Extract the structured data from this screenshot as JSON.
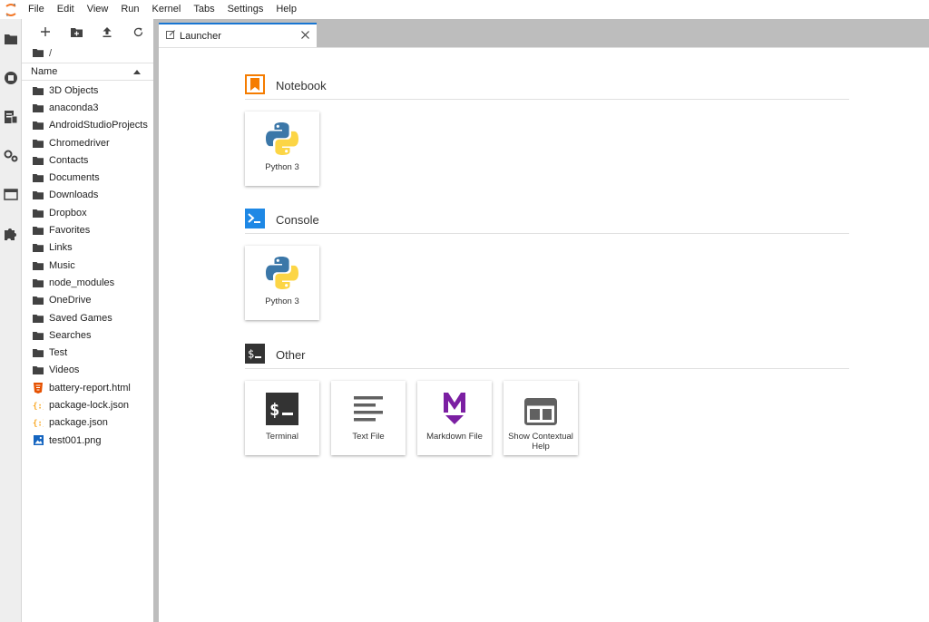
{
  "menubar": {
    "items": [
      "File",
      "Edit",
      "View",
      "Run",
      "Kernel",
      "Tabs",
      "Settings",
      "Help"
    ]
  },
  "filebrowser": {
    "breadcrumb": "/",
    "column_header": "Name",
    "items": [
      {
        "name": "3D Objects",
        "kind": "folder"
      },
      {
        "name": "anaconda3",
        "kind": "folder"
      },
      {
        "name": "AndroidStudioProjects",
        "kind": "folder"
      },
      {
        "name": "Chromedriver",
        "kind": "folder"
      },
      {
        "name": "Contacts",
        "kind": "folder"
      },
      {
        "name": "Documents",
        "kind": "folder"
      },
      {
        "name": "Downloads",
        "kind": "folder"
      },
      {
        "name": "Dropbox",
        "kind": "folder"
      },
      {
        "name": "Favorites",
        "kind": "folder"
      },
      {
        "name": "Links",
        "kind": "folder"
      },
      {
        "name": "Music",
        "kind": "folder"
      },
      {
        "name": "node_modules",
        "kind": "folder"
      },
      {
        "name": "OneDrive",
        "kind": "folder"
      },
      {
        "name": "Saved Games",
        "kind": "folder"
      },
      {
        "name": "Searches",
        "kind": "folder"
      },
      {
        "name": "Test",
        "kind": "folder"
      },
      {
        "name": "Videos",
        "kind": "folder"
      },
      {
        "name": "battery-report.html",
        "kind": "html"
      },
      {
        "name": "package-lock.json",
        "kind": "json"
      },
      {
        "name": "package.json",
        "kind": "json"
      },
      {
        "name": "test001.png",
        "kind": "image"
      }
    ]
  },
  "tab": {
    "label": "Launcher"
  },
  "launcher": {
    "notebook": {
      "title": "Notebook",
      "cards": [
        "Python 3"
      ]
    },
    "console": {
      "title": "Console",
      "cards": [
        "Python 3"
      ]
    },
    "other": {
      "title": "Other",
      "cards": [
        "Terminal",
        "Text File",
        "Markdown File",
        "Show Contextual Help"
      ]
    }
  },
  "colors": {
    "accent": "#1976d2",
    "notebook_orange": "#f57c00",
    "console_blue": "#1e88e5",
    "markdown_purple": "#7b1fa2",
    "folder": "#424242",
    "json_orange": "#f9a825",
    "html_orange": "#e65100",
    "image_blue": "#1565c0"
  }
}
